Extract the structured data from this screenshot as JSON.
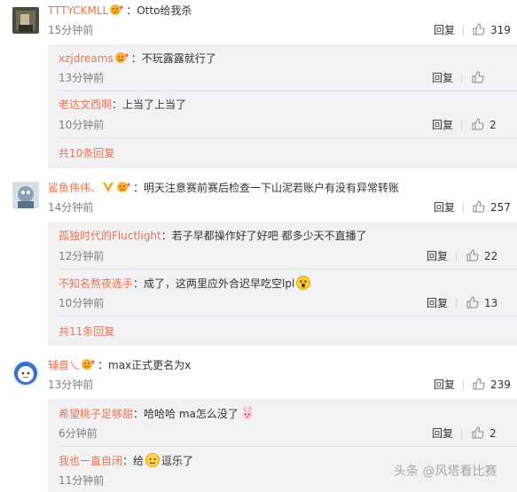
{
  "comments": [
    {
      "user": "TTTYCKMLL",
      "text": "：Otto给我杀",
      "time": "15分钟前",
      "reply_label": "回复",
      "likes": "319",
      "replies": [
        {
          "user": "xzjdreams",
          "text": "：不玩露露就行了",
          "time": "13分钟前",
          "reply_label": "回复",
          "likes": ""
        },
        {
          "user": "老达文西啊",
          "text": "：上当了上当了",
          "time": "10分钟前",
          "reply_label": "回复",
          "likes": "2"
        }
      ],
      "more_label": "共10条回复"
    },
    {
      "user": "鲨鱼伟伟、",
      "text": "：明天注意赛前赛后检查一下山泥若账户有没有异常转账",
      "time": "14分钟前",
      "reply_label": "回复",
      "likes": "257",
      "replies": [
        {
          "user": "孤独时代的Fluctlight",
          "text": "：若子早都操作好了好吧 都多少天不直播了",
          "time": "12分钟前",
          "reply_label": "回复",
          "likes": "22"
        },
        {
          "user": "不知名熬夜选手",
          "text": "：成了，这两里应外合迟早吃空lpl",
          "time": "10分钟前",
          "reply_label": "回复",
          "likes": "13"
        }
      ],
      "more_label": "共11条回复"
    },
    {
      "user": "辅音乀",
      "text": "：max正式更名为x",
      "time": "13分钟前",
      "reply_label": "回复",
      "likes": "239",
      "replies": [
        {
          "user": "希望桃子足够甜",
          "text": "：哈哈哈 ma怎么没了",
          "time": "6分钟前",
          "reply_label": "回复",
          "likes": "2"
        },
        {
          "user": "我也一直自闭",
          "text": "：给",
          "text2": "逗乐了",
          "time": "11分钟前",
          "reply_label": "回复",
          "likes": "2"
        }
      ]
    }
  ],
  "watermark": "头条 @风塔看比赛",
  "colors": {
    "username": "#eb7350",
    "time": "#808080",
    "reply_bg": "#f2f2f5"
  }
}
